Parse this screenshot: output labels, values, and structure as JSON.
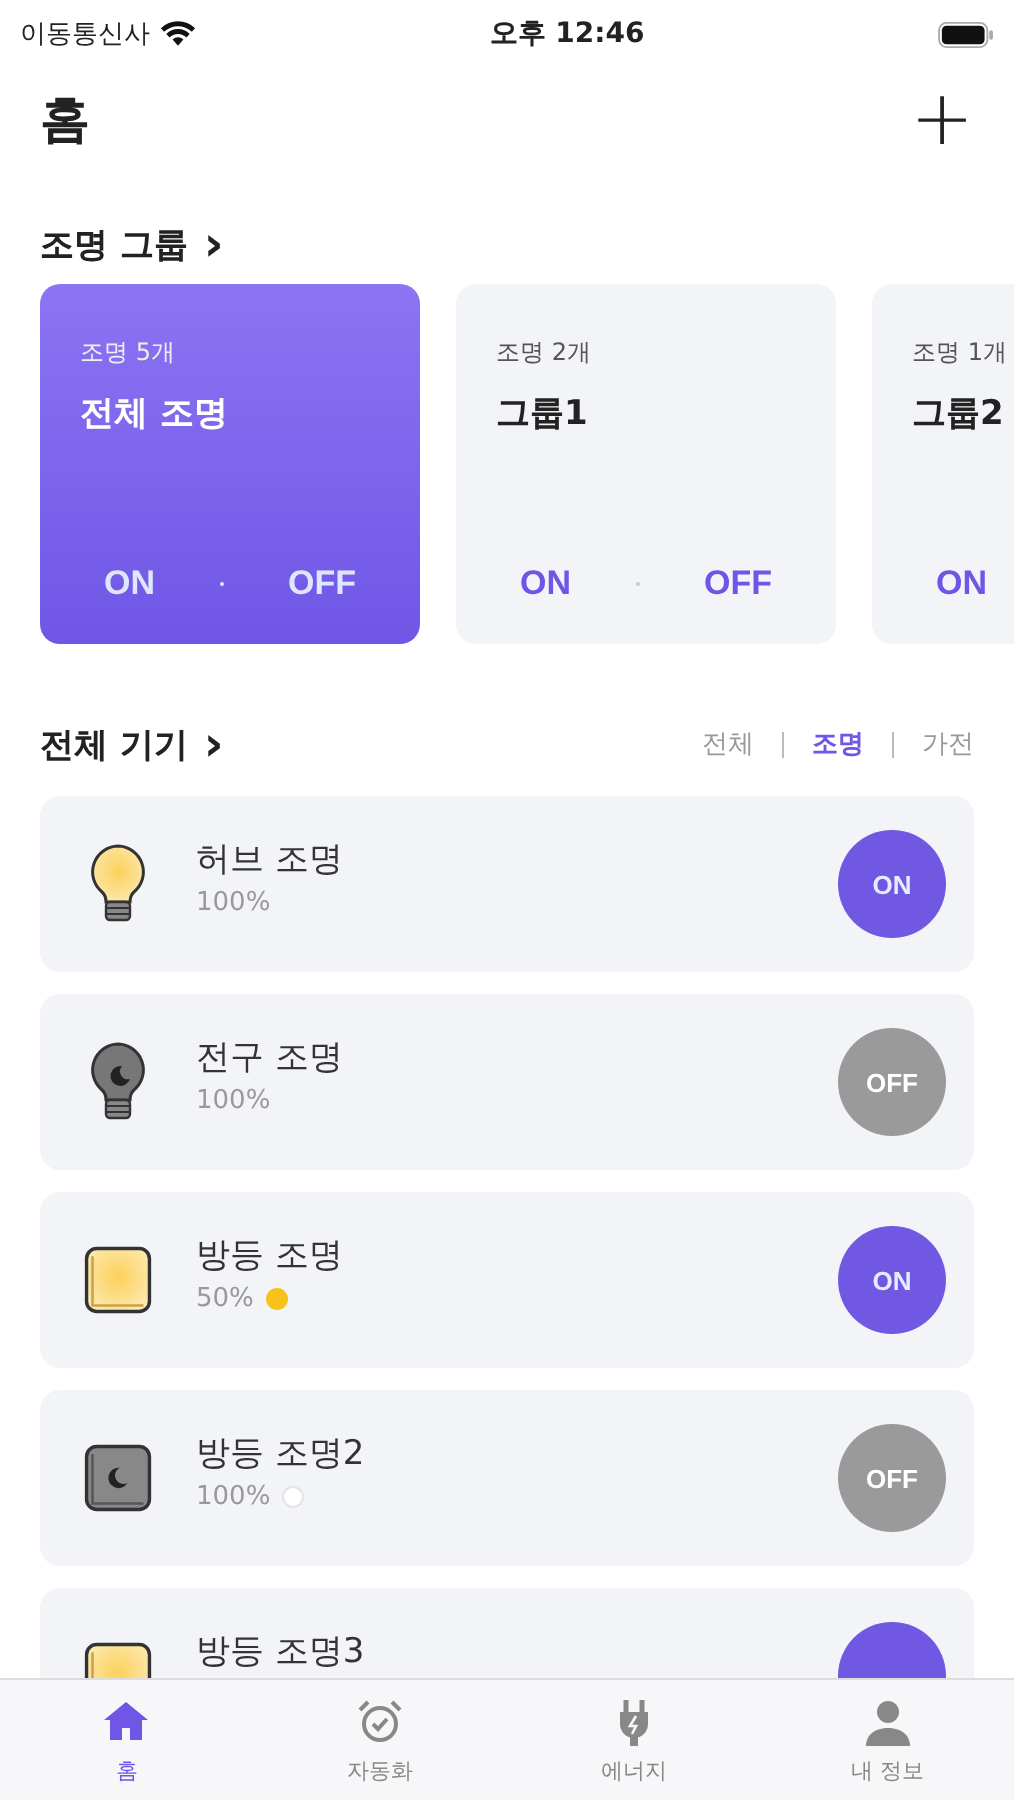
{
  "status_bar": {
    "carrier": "이동통신사",
    "time": "오후 12:46"
  },
  "header": {
    "title": "홈",
    "add_button": "+"
  },
  "group_section": {
    "title": "조명 그룹",
    "chevron": "›"
  },
  "groups": [
    {
      "count": "조명 5개",
      "name": "전체 조명",
      "selected": true,
      "buttons": [
        "ON",
        "OFF"
      ]
    },
    {
      "count": "조명 2개",
      "name": "그룹1",
      "selected": false,
      "buttons": [
        "ON",
        "OFF"
      ]
    },
    {
      "count": "조명 1개",
      "name": "그룹2",
      "selected": false,
      "buttons": [
        "ON"
      ]
    }
  ],
  "device_section": {
    "title": "전체 기기",
    "chevron": "›"
  },
  "filters": [
    {
      "label": "전체",
      "selected": false
    },
    {
      "label": "조명",
      "selected": true
    },
    {
      "label": "가전",
      "selected": false
    }
  ],
  "devices": [
    {
      "kind": "bulb",
      "name": "허브 조명",
      "brightness": "100%",
      "on": true,
      "toggle": "ON"
    },
    {
      "kind": "bulb",
      "name": "전구 조명",
      "brightness": "100%",
      "on": false,
      "toggle": "OFF"
    },
    {
      "kind": "panel",
      "name": "방등 조명",
      "brightness": "50%",
      "color": "#f7c21a",
      "on": true,
      "toggle": "ON"
    },
    {
      "kind": "panel",
      "name": "방등 조명2",
      "brightness": "100%",
      "color": "#ffffff",
      "on": false,
      "toggle": "OFF"
    },
    {
      "kind": "panel",
      "name": "방등 조명3",
      "on": true
    }
  ],
  "tab_bar": [
    {
      "kind": "home",
      "label": "홈",
      "selected": true
    },
    {
      "kind": "alarm",
      "label": "자동화",
      "selected": false
    },
    {
      "kind": "plug",
      "label": "에너지",
      "selected": false
    },
    {
      "kind": "person",
      "label": "내 정보",
      "selected": false
    }
  ]
}
